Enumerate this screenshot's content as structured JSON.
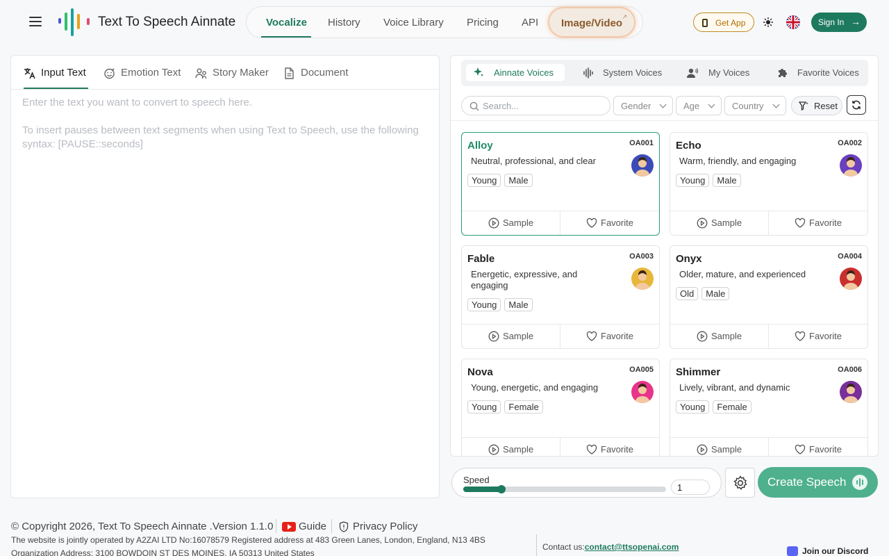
{
  "header": {
    "title": "Text To Speech Ainnate",
    "nav": [
      {
        "label": "Vocalize",
        "active": true
      },
      {
        "label": "History"
      },
      {
        "label": "Voice Library"
      },
      {
        "label": "Pricing"
      },
      {
        "label": "API"
      },
      {
        "label": "Image/Video",
        "external": true
      }
    ],
    "external_glyph": "↗",
    "get_app": "Get App",
    "sign_in": "Sign In",
    "sign_in_arrow": "→",
    "icons": [
      "menu-icon",
      "logo-icon",
      "phone-icon",
      "sun-icon",
      "uk-flag-icon",
      "arrow-right-icon"
    ],
    "colors": {
      "brand": "#1e7a5e",
      "logo": [
        "#e8a317",
        "#e24b6e",
        "#1aa0a0",
        "#4a57d0",
        "#2fbf6a"
      ]
    }
  },
  "input_panel": {
    "tabs": [
      {
        "label": "Input Text",
        "icon": "translate-icon",
        "active": true
      },
      {
        "label": "Emotion Text",
        "icon": "emotion-icon"
      },
      {
        "label": "Story Maker",
        "icon": "people-icon"
      },
      {
        "label": "Document",
        "icon": "document-icon"
      }
    ],
    "placeholder_line1": "Enter the text you want to convert to speech here.",
    "placeholder_line2": "To insert pauses between text segments when using Text to Speech, use the following syntax: [PAUSE::seconds]"
  },
  "voice_panel": {
    "tabs": [
      {
        "label": "Ainnate Voices",
        "icon": "sparkle-icon",
        "active": true
      },
      {
        "label": "System Voices",
        "icon": "waveform-icon"
      },
      {
        "label": "My Voices",
        "icon": "user-voice-icon"
      },
      {
        "label": "Favorite Voices",
        "icon": "puzzle-icon"
      }
    ],
    "search_placeholder": "Search...",
    "filters": {
      "gender": "Gender",
      "age": "Age",
      "country": "Country"
    },
    "reset": "Reset",
    "sample_label": "Sample",
    "favorite_label": "Favorite",
    "voices": [
      {
        "name": "Alloy",
        "code": "OA001",
        "desc": "Neutral, professional, and clear",
        "tags": [
          "Young",
          "Male"
        ],
        "selected": true,
        "avatar_color": "#3b4cb8"
      },
      {
        "name": "Echo",
        "code": "OA002",
        "desc": "Warm, friendly, and engaging",
        "tags": [
          "Young",
          "Male"
        ],
        "avatar_color": "#6a3fc0"
      },
      {
        "name": "Fable",
        "code": "OA003",
        "desc": "Energetic, expressive, and engaging",
        "tags": [
          "Young",
          "Male"
        ],
        "avatar_color": "#e8b63a"
      },
      {
        "name": "Onyx",
        "code": "OA004",
        "desc": "Older, mature, and experienced",
        "tags": [
          "Old",
          "Male"
        ],
        "avatar_color": "#c8302e"
      },
      {
        "name": "Nova",
        "code": "OA005",
        "desc": "Young, energetic, and engaging",
        "tags": [
          "Young",
          "Female"
        ],
        "avatar_color": "#e8348a"
      },
      {
        "name": "Shimmer",
        "code": "OA006",
        "desc": "Lively, vibrant, and dynamic",
        "tags": [
          "Young",
          "Female"
        ],
        "avatar_color": "#7a2f9a"
      }
    ]
  },
  "controls": {
    "speed_label": "Speed",
    "speed_value": "1",
    "speed_fraction": 0.19,
    "create_label": "Create Speech"
  },
  "footer": {
    "copyright": "© Copyright 2026, Text To Speech Ainnate .Version 1.1.0",
    "guide": "Guide",
    "privacy": "Privacy Policy",
    "operated": "The website is jointly operated by A2ZAI LTD No:16078579 Registered address at 483 Green Lanes, London, England, N13 4BS",
    "org": "Organization Address: 3100 BOWDOIN ST DES MOINES, IA 50313 United States",
    "contact_label": "Contact us:",
    "contact_email": "contact@ttsopenai.com",
    "discord": "Join our Discord"
  }
}
